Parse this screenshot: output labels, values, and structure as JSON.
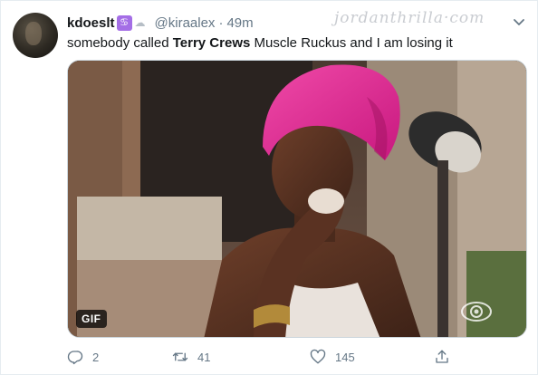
{
  "tweet": {
    "display_name": "kdoeslt",
    "emoji_1": "♋",
    "emoji_2": "☁",
    "handle": "@kiraalex",
    "dot": "·",
    "time": "49m",
    "text_before": "somebody called ",
    "text_bold": "Terry Crews",
    "text_after": " Muscle Ruckus and I am losing it"
  },
  "watermark": "jordanthrilla·com",
  "media": {
    "badge": "GIF",
    "overlay_logo": "cbs-eye-logo"
  },
  "actions": {
    "reply_count": "2",
    "retweet_count": "41",
    "like_count": "145",
    "share_label": ""
  },
  "icons": {
    "reply": "reply-icon",
    "retweet": "retweet-icon",
    "like": "heart-icon",
    "share": "share-icon",
    "more": "chevron-down-icon"
  },
  "colors": {
    "text_primary": "#14171a",
    "text_secondary": "#657786",
    "towel_pink": "#e5259a"
  }
}
